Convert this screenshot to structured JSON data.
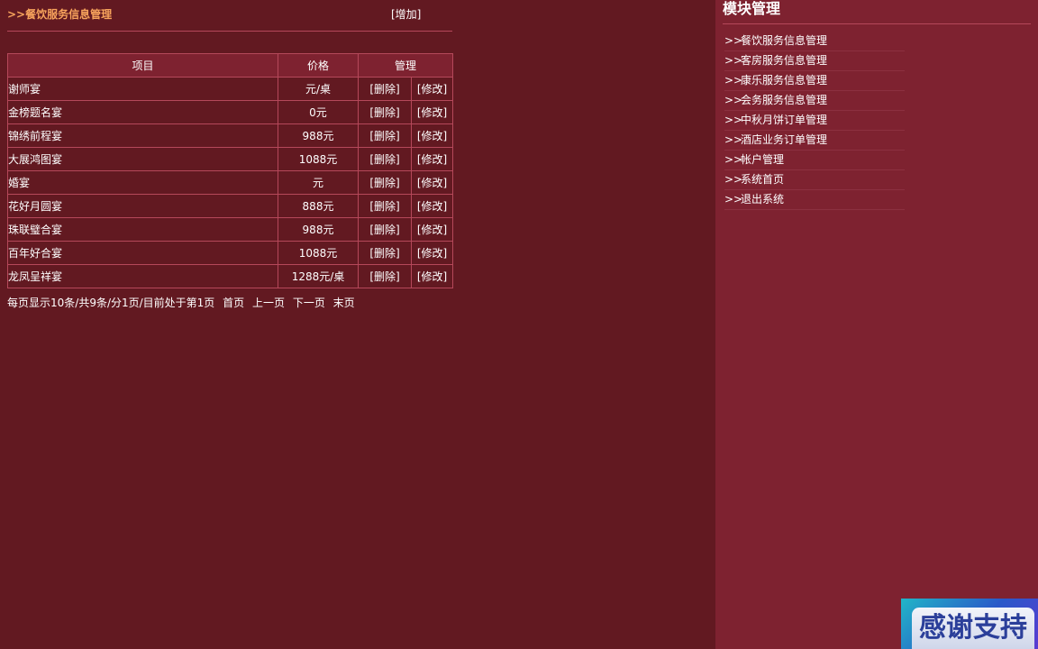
{
  "main": {
    "title": ">>餐饮服务信息管理",
    "add_label": "[增加]"
  },
  "table": {
    "headers": {
      "item": "项目",
      "price": "价格",
      "manage": "管理"
    },
    "delete_label": "[删除]",
    "edit_label": "[修改]",
    "rows": [
      {
        "name": "谢师宴",
        "price": "元/桌"
      },
      {
        "name": "金榜题名宴",
        "price": "0元"
      },
      {
        "name": "锦绣前程宴",
        "price": "988元"
      },
      {
        "name": "大展鸿图宴",
        "price": "1088元"
      },
      {
        "name": "婚宴",
        "price": "元"
      },
      {
        "name": "花好月圆宴",
        "price": "888元"
      },
      {
        "name": "珠联璧合宴",
        "price": "988元"
      },
      {
        "name": "百年好合宴",
        "price": "1088元"
      },
      {
        "name": "龙凤呈祥宴",
        "price": "1288元/桌"
      }
    ]
  },
  "pager": {
    "info": "每页显示10条/共9条/分1页/目前处于第1页",
    "first": "首页",
    "prev": "上一页",
    "next": "下一页",
    "last": "末页"
  },
  "sidebar": {
    "title": "模块管理",
    "arrow": ">>",
    "items": [
      {
        "label": "餐饮服务信息管理"
      },
      {
        "label": "客房服务信息管理"
      },
      {
        "label": "康乐服务信息管理"
      },
      {
        "label": "会务服务信息管理"
      },
      {
        "label": "中秋月饼订单管理"
      },
      {
        "label": "酒店业务订单管理"
      },
      {
        "label": "帐户管理"
      },
      {
        "label": "系统首页"
      },
      {
        "label": "退出系统"
      }
    ]
  },
  "badge": {
    "text": "感谢支持"
  },
  "colors": {
    "main_bg": "#621921",
    "sidebar_bg": "#7e2230",
    "title_accent": "#f7a35c",
    "border": "#b5485a"
  }
}
